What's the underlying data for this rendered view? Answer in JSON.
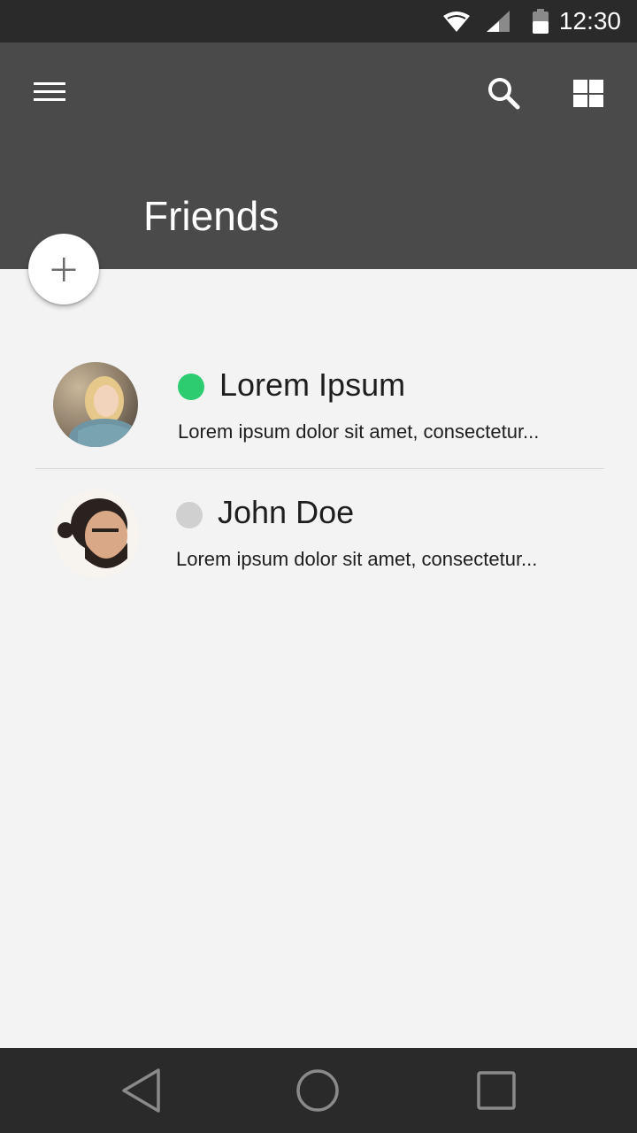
{
  "status_bar": {
    "time": "12:30",
    "icons": [
      "wifi-icon",
      "signal-icon",
      "battery-icon"
    ]
  },
  "app_bar": {
    "title": "Friends",
    "icons": [
      "menu-icon",
      "search-icon",
      "grid-view-icon"
    ],
    "background": "#4a4a4a"
  },
  "fab": {
    "icon": "plus-icon"
  },
  "friends": [
    {
      "name": "Lorem Ipsum",
      "message": "Lorem ipsum dolor sit amet, consectetur...",
      "online": true,
      "status_color": "#2ecc71"
    },
    {
      "name": "John Doe",
      "message": "Lorem ipsum dolor sit amet, consectetur...",
      "online": false,
      "status_color": "#d0d0d0"
    }
  ],
  "nav_bar": {
    "icons": [
      "back-icon",
      "home-icon",
      "recents-icon"
    ]
  }
}
